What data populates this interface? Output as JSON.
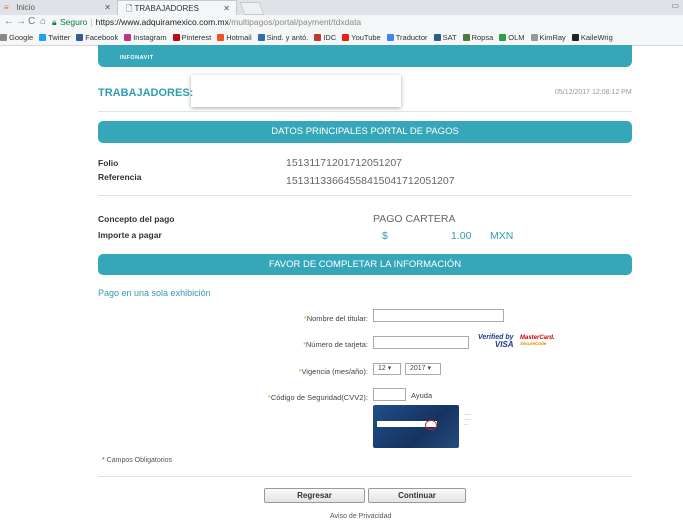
{
  "browser": {
    "tabs": [
      {
        "label": "Inicio"
      },
      {
        "label": "TRABAJADORES"
      }
    ],
    "url": {
      "secure_label": "Seguro",
      "host": "https://www.adquiramexico.com.mx",
      "path": "/multipagos/portal/payment/tdxdata"
    },
    "bookmarks": [
      {
        "label": "Google",
        "icon": "google-icon"
      },
      {
        "label": "Twitter",
        "icon": "twitter-icon",
        "color": "#1da1f2"
      },
      {
        "label": "Facebook",
        "icon": "facebook-icon",
        "color": "#3b5998"
      },
      {
        "label": "Instagram",
        "icon": "instagram-icon",
        "color": "#c13584"
      },
      {
        "label": "Pinterest",
        "icon": "pinterest-icon",
        "color": "#bd081c"
      },
      {
        "label": "Hotmail",
        "icon": "hotmail-icon",
        "color": "#f25022"
      },
      {
        "label": "Sind. y antó.",
        "icon": "sind-icon",
        "color": "#2c6db5"
      },
      {
        "label": "IDC",
        "icon": "idc-icon",
        "color": "#c0392b"
      },
      {
        "label": "YouTube",
        "icon": "youtube-icon",
        "color": "#e62117"
      },
      {
        "label": "Traductor",
        "icon": "translate-icon",
        "color": "#4285f4"
      },
      {
        "label": "SAT",
        "icon": "sat-icon",
        "color": "#2a5c8c"
      },
      {
        "label": "Ropsa",
        "icon": "ropsa-icon",
        "color": "#4a7c3a"
      },
      {
        "label": "OLM",
        "icon": "olm-icon",
        "color": "#2c9f45"
      },
      {
        "label": "KimRay",
        "icon": "kimray-icon",
        "color": "#999999"
      },
      {
        "label": "KaileWrig",
        "icon": "kailewrig-icon",
        "color": "#222222"
      }
    ]
  },
  "page": {
    "banner_text": "INFONAVIT",
    "trabajadores_label": "TRABAJADORES:",
    "timestamp": "05/12/2017 12:08:12 PM",
    "section1_title": "DATOS PRINCIPALES PORTAL DE PAGOS",
    "folio_label": "Folio",
    "folio_value": "15131171201712051207",
    "referencia_label": "Referencia",
    "referencia_value": "15131133664558415041712051207",
    "concepto_label": "Concepto del pago",
    "concepto_value": "PAGO CARTERA",
    "importe_label": "Importe a pagar",
    "currency_symbol": "$",
    "importe_value": "1.00",
    "currency": "MXN",
    "section2_title": "FAVOR DE COMPLETAR LA INFORMACIÓN",
    "payment_link": "Pago en una sola exhibición",
    "form": {
      "nombre_label": "Nombre del titular:",
      "tarjeta_label": "Número de tarjeta:",
      "vigencia_label": "Vigencia (mes/año):",
      "mes_value": "12",
      "anio_value": "2017",
      "codigo_label": "Código de Seguridad(CVV2):",
      "ayuda_label": "Ayuda",
      "verified_line1": "Verified by",
      "verified_line2": "VISA",
      "mastercard_line1": "MasterCard.",
      "mastercard_line2": "SecureCode"
    },
    "campos_obligatorios": "* Campos Obligatorios",
    "regresar_label": "Regresar",
    "continuar_label": "Continuar",
    "aviso_label": "Aviso de Privacidad"
  },
  "colors": {
    "accent": "#36a7b8",
    "accent_text": "#2f9db0"
  }
}
